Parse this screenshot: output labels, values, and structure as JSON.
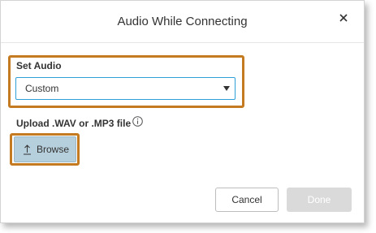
{
  "dialog": {
    "title": "Audio While Connecting",
    "close_icon": "close-icon"
  },
  "set_audio": {
    "label": "Set Audio",
    "selected": "Custom"
  },
  "upload": {
    "label": "Upload .WAV or .MP3 file",
    "info_icon": "info-icon",
    "browse_label": "Browse",
    "browse_icon": "upload-arrow-icon"
  },
  "footer": {
    "cancel_label": "Cancel",
    "done_label": "Done"
  },
  "colors": {
    "highlight": "#c47a20",
    "select_border": "#2f9fd8",
    "browse_bg": "#b6cfdc",
    "done_disabled_bg": "#dadada"
  }
}
